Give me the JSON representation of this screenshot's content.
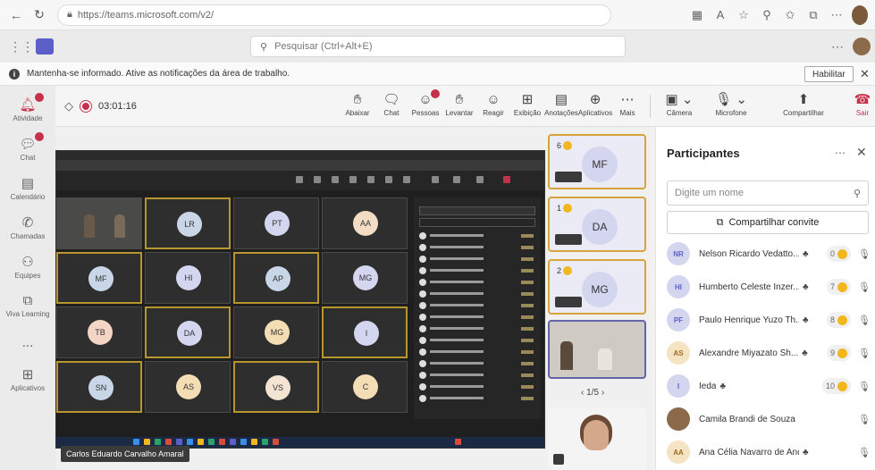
{
  "browser": {
    "url": "https://teams.microsoft.com/v2/",
    "nav": [
      "back-icon",
      "refresh-icon",
      "lock-icon"
    ]
  },
  "teams_top": {
    "search_placeholder": "Pesquisar (Ctrl+Alt+E)"
  },
  "notification": {
    "text": "Mantenha-se informado. Ative as notificações da área de trabalho.",
    "button": "Habilitar"
  },
  "rail": [
    {
      "label": "Atividade",
      "icon": "bell-icon"
    },
    {
      "label": "Chat",
      "icon": "chat-icon"
    },
    {
      "label": "Calendário",
      "icon": "calendar-icon"
    },
    {
      "label": "Chamadas",
      "icon": "phone-icon"
    },
    {
      "label": "Equipes",
      "icon": "teams-icon"
    },
    {
      "label": "Viva Learning",
      "icon": "learning-icon"
    },
    {
      "label": "...",
      "icon": "more-icon"
    },
    {
      "label": "Aplicativos",
      "icon": "apps-icon"
    }
  ],
  "meeting": {
    "timer": "03:01:16",
    "tools": [
      {
        "label": "Abaixar",
        "icon": "hand-down-icon"
      },
      {
        "label": "Chat",
        "icon": "chat-icon"
      },
      {
        "label": "Pessoas",
        "icon": "people-icon"
      },
      {
        "label": "Levantar",
        "icon": "raise-hand-icon"
      },
      {
        "label": "Reagir",
        "icon": "react-icon"
      },
      {
        "label": "Exibição",
        "icon": "view-icon"
      },
      {
        "label": "Anotações",
        "icon": "notes-icon"
      },
      {
        "label": "Aplicativos",
        "icon": "add-app-icon"
      },
      {
        "label": "Mais",
        "icon": "more-icon"
      },
      {
        "label": "Câmera",
        "icon": "camera-off-icon"
      },
      {
        "label": "Microfone",
        "icon": "mic-off-icon"
      },
      {
        "label": "Compartilhar",
        "icon": "share-icon"
      }
    ],
    "leave_label": "Sair",
    "presenter_name": "Carlos Eduardo Carvalho Amaral"
  },
  "shared_tiles": [
    {
      "initials": "",
      "video": true
    },
    {
      "initials": "LR",
      "color": "#c8d6e8"
    },
    {
      "initials": "PT",
      "color": "#d4d6f0"
    },
    {
      "initials": "AA",
      "color": "#f4dcc4"
    },
    {
      "initials": "MF",
      "color": "#c8d6e8"
    },
    {
      "initials": "HI",
      "color": "#d4d6f0"
    },
    {
      "initials": "AP",
      "color": "#c8d6e8"
    },
    {
      "initials": "MG",
      "color": "#d4d6f0"
    },
    {
      "initials": "TB",
      "color": "#f4d4c4"
    },
    {
      "initials": "DA",
      "color": "#d4d6f0"
    },
    {
      "initials": "MG",
      "color": "#f4dcb4"
    },
    {
      "initials": "I",
      "color": "#d4d6f0"
    },
    {
      "initials": "SN",
      "color": "#c8d6e8"
    },
    {
      "initials": "AS",
      "color": "#f4dcb4"
    },
    {
      "initials": "VS",
      "color": "#f4e4d4"
    },
    {
      "initials": "C",
      "color": "#f4dcb4"
    }
  ],
  "strip": {
    "tiles": [
      {
        "initials": "MF",
        "hand": "6",
        "color": "#d4d6f0"
      },
      {
        "initials": "DA",
        "hand": "1",
        "color": "#d4d6f0"
      },
      {
        "initials": "MG",
        "hand": "2",
        "color": "#d4d6f0"
      }
    ],
    "pager": "1/5"
  },
  "panel": {
    "title": "Participantes",
    "search_placeholder": "Digite um nome",
    "share_label": "Compartilhar convite",
    "participants": [
      {
        "initials": "NR",
        "name": "Nelson Ricardo Vedatto...",
        "sharing": true,
        "count": "0",
        "color": "#d4d6f0",
        "fg": "#5b5fc7"
      },
      {
        "initials": "HI",
        "name": "Humberto Celeste Inzer...",
        "sharing": true,
        "count": "7",
        "color": "#d4d6f0",
        "fg": "#5b5fc7"
      },
      {
        "initials": "PF",
        "name": "Paulo Henrique Yuzo Th...",
        "sharing": true,
        "count": "8",
        "color": "#d4d6f0",
        "fg": "#5b5fc7"
      },
      {
        "initials": "AS",
        "name": "Alexandre Miyazato Sh...",
        "sharing": true,
        "count": "9",
        "color": "#f4e4c4",
        "fg": "#a06a1a"
      },
      {
        "initials": "I",
        "name": "Ieda",
        "sharing": true,
        "count": "10",
        "color": "#d4d6f0",
        "fg": "#5b5fc7"
      },
      {
        "initials": "",
        "name": "Camila Brandi de Souza",
        "sharing": false,
        "count": "",
        "color": "#8a6a4a",
        "fg": "#fff"
      },
      {
        "initials": "AA",
        "name": "Ana Célia Navarro de Andrade",
        "sharing": true,
        "count": "",
        "color": "#f4e4c4",
        "fg": "#a06a1a"
      }
    ]
  }
}
